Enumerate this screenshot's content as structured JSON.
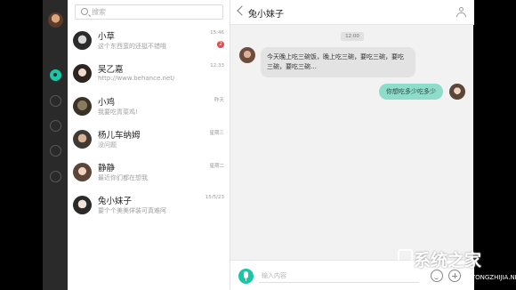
{
  "search": {
    "placeholder": "搜索"
  },
  "colors": {
    "accent": "#19c7a4",
    "badge": "#e94848",
    "bubble_out": "#8edcca",
    "bubble_in": "#e3e3e3"
  },
  "rail": {
    "icons": [
      "avatar",
      "chat-icon",
      "compass-icon",
      "contacts-icon",
      "history-icon",
      "settings-icon"
    ]
  },
  "chats": [
    {
      "name": "小草",
      "msg": "这个东西蛮的还挺不错哦",
      "time": "15:46",
      "badge": "2"
    },
    {
      "name": "吴乙嘉",
      "msg": "http://www.behance.net/",
      "time": "12:33",
      "badge": ""
    },
    {
      "name": "小鸡",
      "msg": "我要吃青菜鸡!",
      "time": "昨天",
      "badge": ""
    },
    {
      "name": "杨儿车纳姆",
      "msg": "没问题",
      "time": "星期三",
      "badge": ""
    },
    {
      "name": "静静",
      "msg": "最近你们都在想我",
      "time": "星期二",
      "badge": ""
    },
    {
      "name": "兔小妹子",
      "msg": "要个个美美佯装可真难阿",
      "time": "15/5/23",
      "badge": ""
    }
  ],
  "conversation": {
    "title": "兔小妹子",
    "stamp": "12:00",
    "incoming": "今天晚上吃三碗饭，晚上吃三碗，要吃三碗，要吃三碗，要吃三碗…",
    "outgoing": "你想吃多少吃多少",
    "input_placeholder": "输入内容"
  },
  "watermark": {
    "main": "系统之家",
    "sub": "XITONGZHIJIA.NET"
  }
}
